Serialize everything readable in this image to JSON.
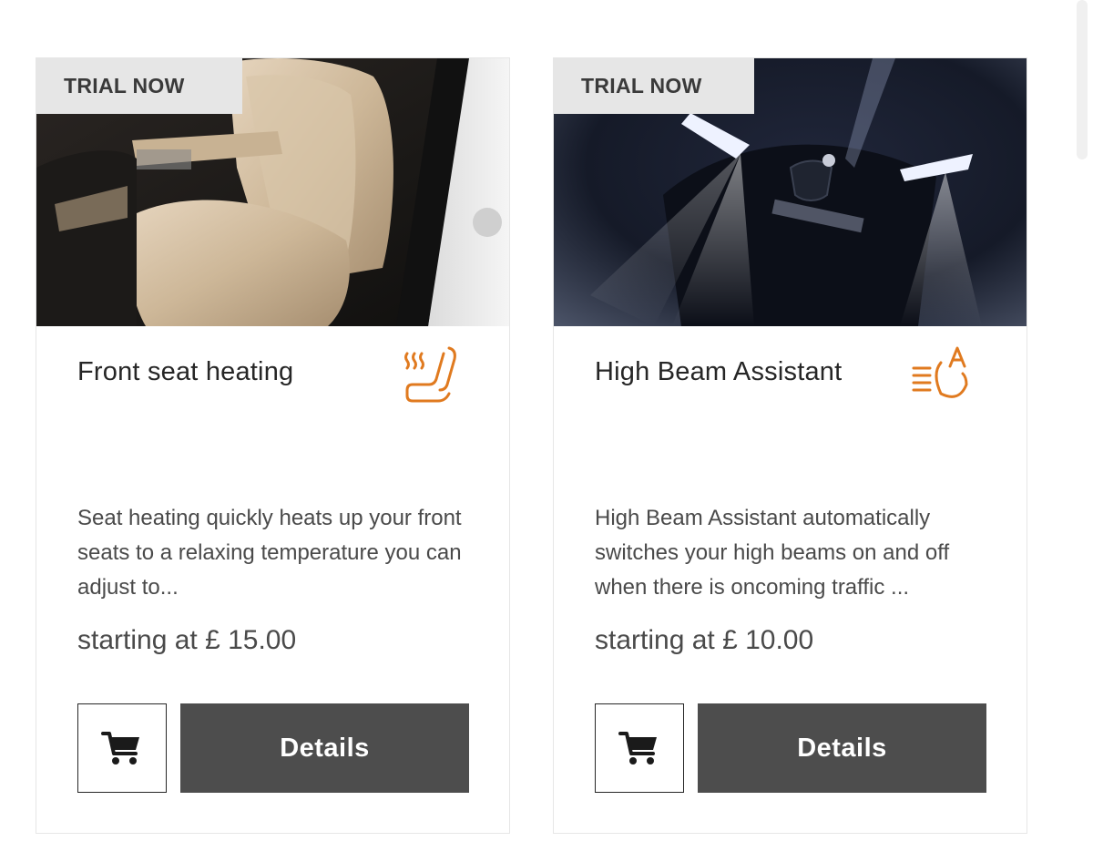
{
  "accent_color": "#e07a1f",
  "button_color": "#4d4d4d",
  "cards": [
    {
      "badge": "TRIAL NOW",
      "title": "Front seat heating",
      "icon": "seat-heating-icon",
      "description": "Seat heating quickly heats up your front seats to a relaxing temperature you can adjust to...",
      "price": "starting at £ 15.00",
      "details_label": "Details",
      "cart_icon": "cart-icon"
    },
    {
      "badge": "TRIAL NOW",
      "title": "High Beam Assistant",
      "icon": "high-beam-assistant-icon",
      "description": "High Beam Assistant automatically switches your high beams on and off when there is oncoming traffic ...",
      "price": "starting at £ 10.00",
      "details_label": "Details",
      "cart_icon": "cart-icon"
    }
  ]
}
